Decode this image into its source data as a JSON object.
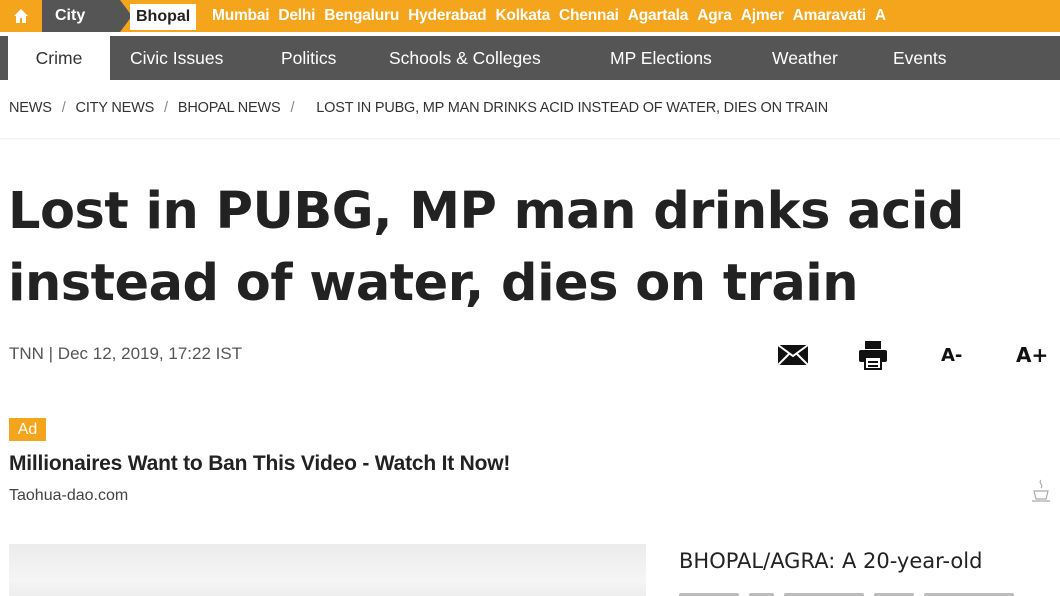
{
  "city_nav": {
    "label": "City",
    "current": "Bhopal",
    "cities": [
      "Mumbai",
      "Delhi",
      "Bengaluru",
      "Hyderabad",
      "Kolkata",
      "Chennai",
      "Agartala",
      "Agra",
      "Ajmer",
      "Amaravati",
      "A"
    ]
  },
  "category_nav": {
    "items": [
      "Crime",
      "Civic Issues",
      "Politics",
      "Schools & Colleges",
      "MP Elections",
      "Weather",
      "Events"
    ],
    "active": "Crime"
  },
  "breadcrumb": {
    "items": [
      "NEWS",
      "CITY NEWS",
      "BHOPAL NEWS"
    ],
    "separator": "/",
    "current": "LOST IN PUBG, MP MAN DRINKS ACID INSTEAD OF WATER, DIES ON TRAIN"
  },
  "article": {
    "headline_line1": "Lost in PUBG, MP man drinks acid",
    "headline_line2": "instead of water, dies on train",
    "byline": "TNN | Dec 12, 2019, 17:22 IST",
    "tools": {
      "email_icon": "envelope-icon",
      "print_icon": "printer-icon",
      "font_decrease": "A-",
      "font_increase": "A+"
    },
    "lead": "BHOPAL/AGRA: A 20-year-old"
  },
  "ad": {
    "badge": "Ad",
    "title": "Millionaires Want to Ban This Video - Watch It Now!",
    "source": "Taohua-dao.com",
    "icon": "ad-choices-icon"
  },
  "colors": {
    "accent": "#f4a51c",
    "nav_dark": "#555555",
    "text": "#222222"
  }
}
